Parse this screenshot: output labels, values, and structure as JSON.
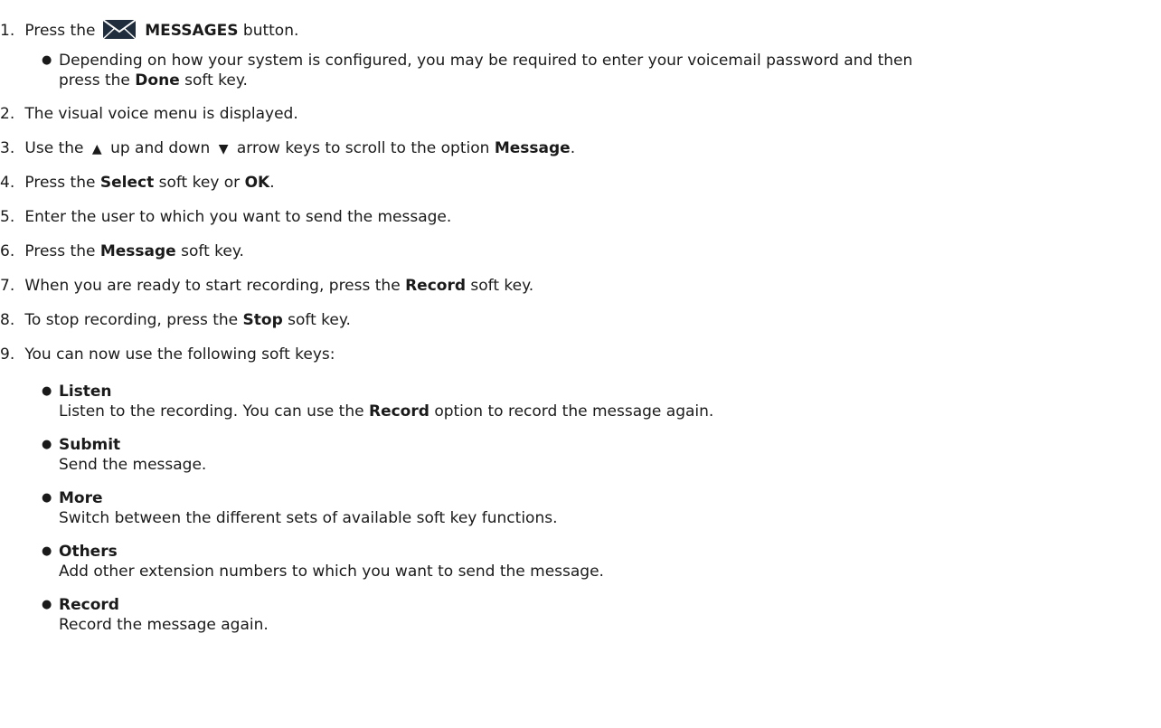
{
  "steps": [
    {
      "num": "1.",
      "pre": "Press the",
      "bold": "MESSAGES",
      "post": "button.",
      "icon": "envelope-icon"
    },
    {
      "num": "2.",
      "text": "The visual voice menu is displayed."
    },
    {
      "num": "3.",
      "pre": "Use the",
      "up_icon": "up-arrow-icon",
      "mid": "up and down",
      "down_icon": "down-arrow-icon",
      "post": "arrow keys to scroll to the option",
      "bold": "Message",
      "end": "."
    },
    {
      "num": "4.",
      "pre": "Press the",
      "bold1": "Select",
      "mid": "soft key or",
      "bold2": "OK",
      "end": "."
    },
    {
      "num": "5.",
      "text": "Enter the user to which you want to send the message."
    },
    {
      "num": "6.",
      "pre": "Press the",
      "bold": "Message",
      "post": "soft key."
    },
    {
      "num": "7.",
      "pre": "When you are ready to start recording, press the",
      "bold": "Record",
      "post": "soft key."
    },
    {
      "num": "8.",
      "pre": "To stop recording, press the",
      "bold": "Stop",
      "post": "soft key."
    },
    {
      "num": "9.",
      "text": "You can now use the following soft keys:"
    }
  ],
  "step1_note": {
    "line1": "Depending on how your system is configured, you may be required to enter your voicemail password and then",
    "line2_pre": "press the",
    "line2_bold": "Done",
    "line2_post": "soft key."
  },
  "soft_keys": [
    {
      "title": "Listen",
      "desc_pre": "Listen to the recording. You can use the",
      "desc_bold": "Record",
      "desc_post": "option to record the message again."
    },
    {
      "title": "Submit",
      "desc": "Send the message."
    },
    {
      "title": "More",
      "desc": "Switch between the different sets of available soft key functions."
    },
    {
      "title": "Others",
      "desc": "Add other extension numbers to which you want to send the message."
    },
    {
      "title": "Record",
      "desc": "Record the message again."
    }
  ],
  "colors": {
    "text": "#1a1a1a",
    "icon": "#1f2d3d"
  }
}
